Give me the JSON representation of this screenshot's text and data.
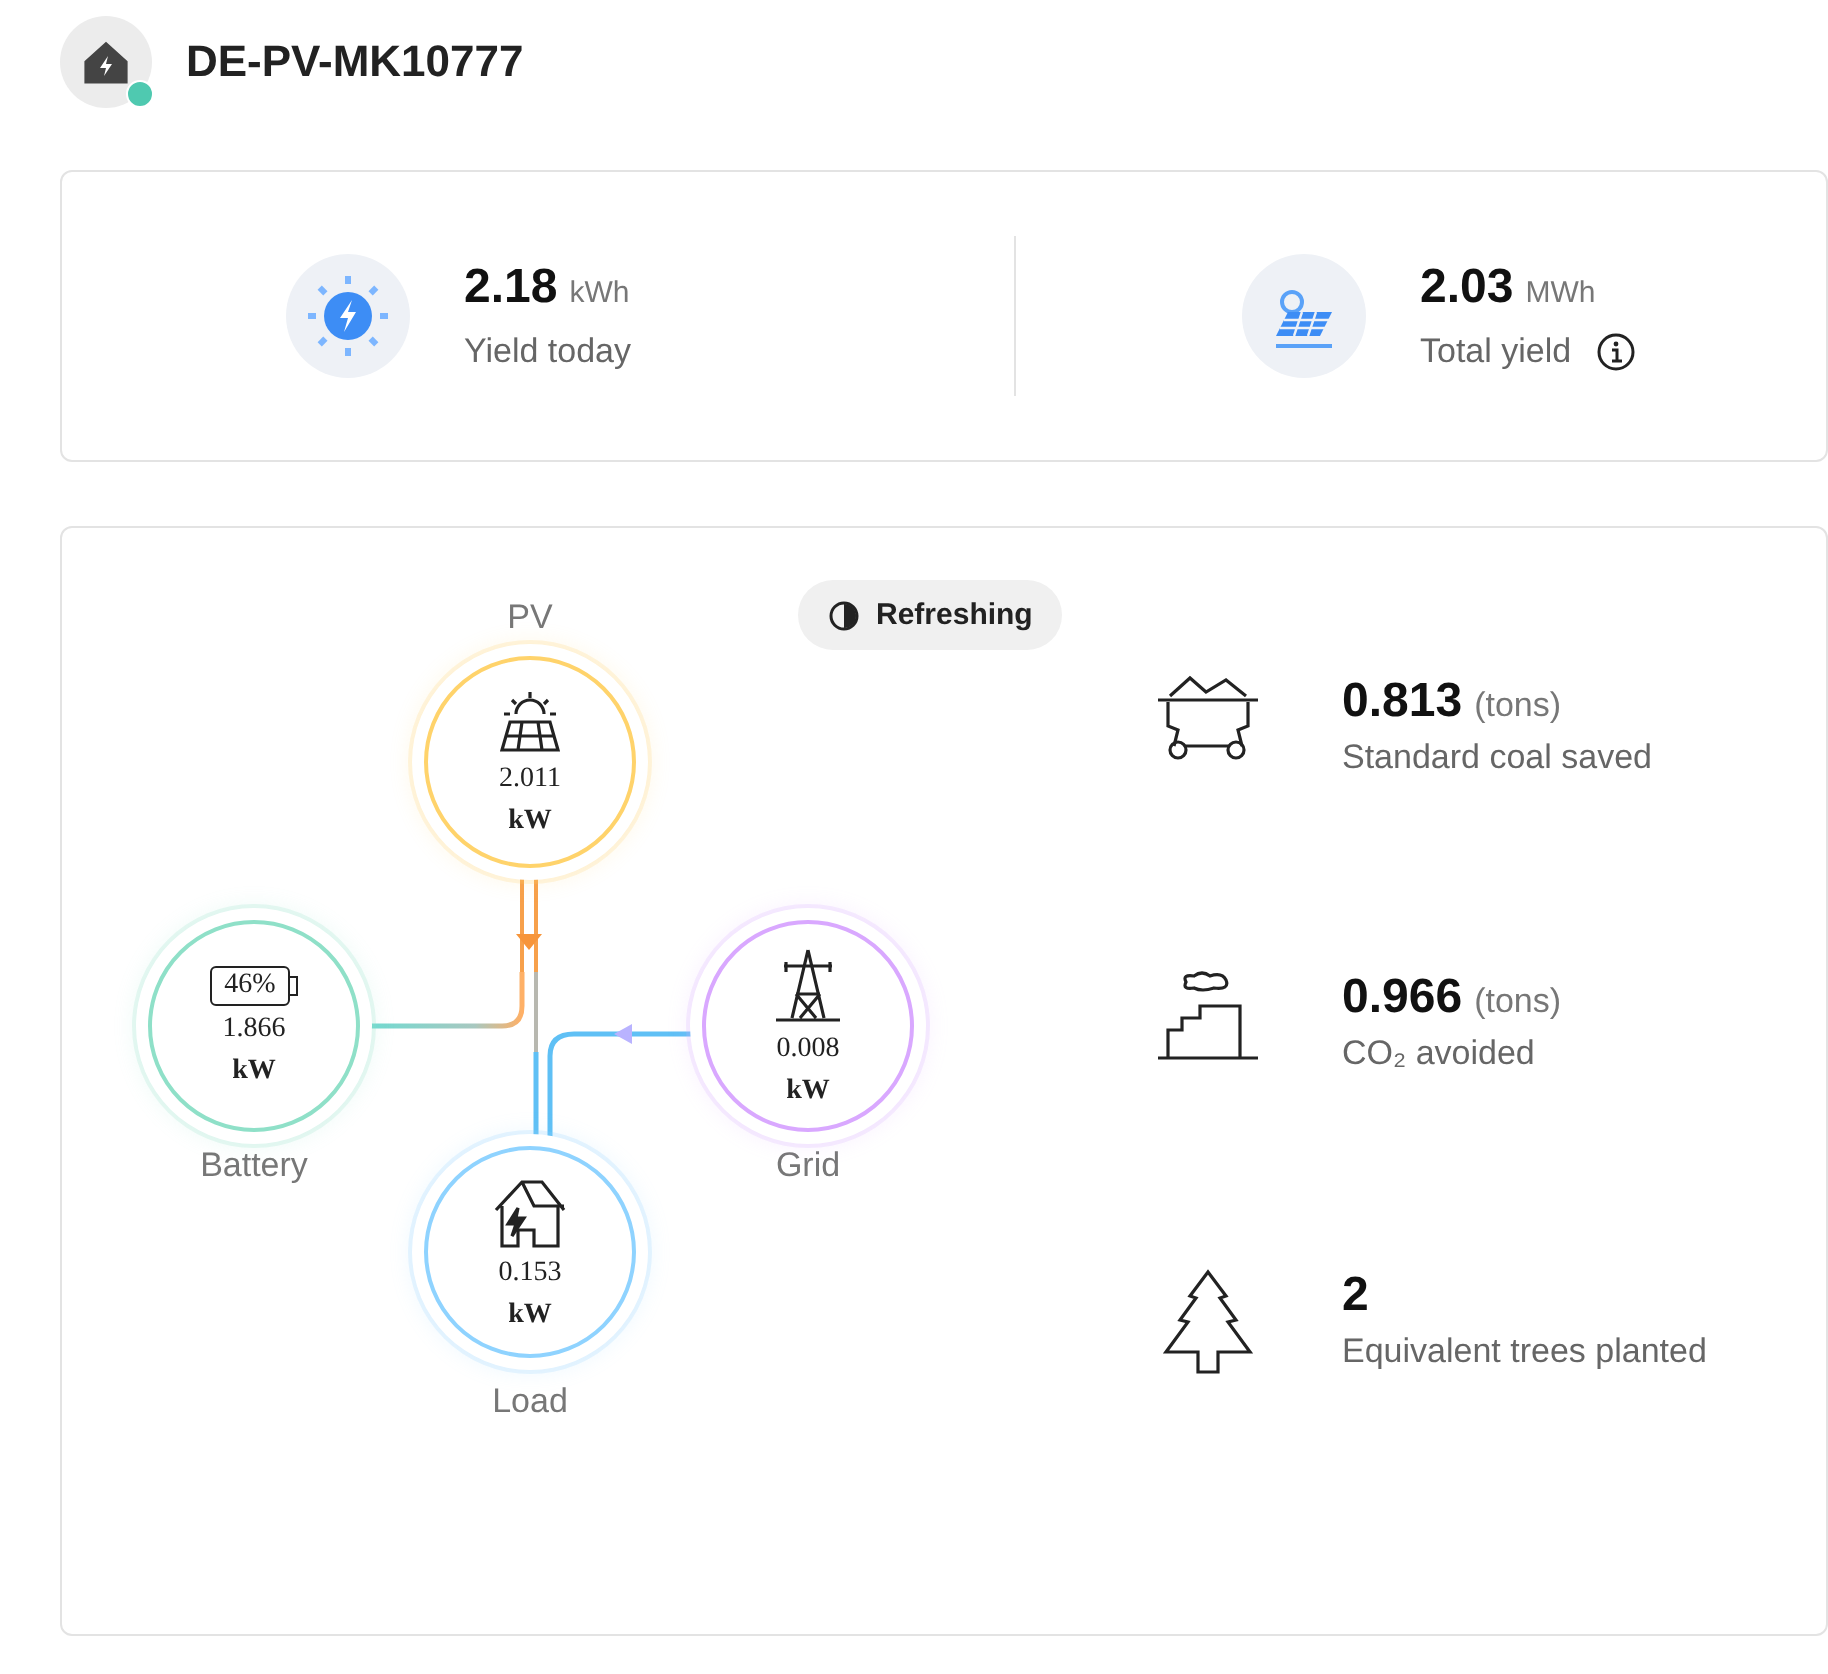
{
  "site": {
    "name": "DE-PV-MK10777",
    "online": true
  },
  "yield": [
    {
      "kind": "today",
      "value": "2.18",
      "unit": "kWh",
      "label": "Yield today",
      "info": false
    },
    {
      "kind": "total",
      "value": "2.03",
      "unit": "MWh",
      "label": "Total yield",
      "info": true
    }
  ],
  "flow": {
    "refresh_label": "Refreshing",
    "nodes": [
      {
        "kind": "pv",
        "label": "PV",
        "value": "2.011",
        "unit": "kW"
      },
      {
        "kind": "battery",
        "label": "Battery",
        "value": "1.866",
        "unit": "kW",
        "charge": "46%"
      },
      {
        "kind": "grid",
        "label": "Grid",
        "value": "0.008",
        "unit": "kW"
      },
      {
        "kind": "load",
        "label": "Load",
        "value": "0.153",
        "unit": "kW"
      }
    ]
  },
  "benefits": [
    {
      "kind": "coal",
      "value": "0.813",
      "unit": "(tons)",
      "label": "Standard coal saved"
    },
    {
      "kind": "co2",
      "value": "0.966",
      "unit": "(tons)",
      "label": "CO₂ avoided"
    },
    {
      "kind": "trees",
      "value": "2",
      "label": "Equivalent trees planted"
    }
  ]
}
